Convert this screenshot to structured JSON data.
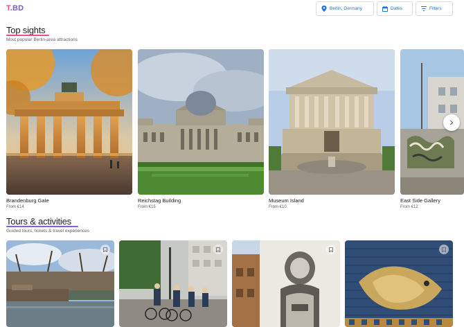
{
  "header": {
    "logo": {
      "t": "T",
      "dot": ".",
      "bd": "BD"
    },
    "location_chip": {
      "label": "Berlin, Germany",
      "icon": "location-pin-icon"
    },
    "dates_chip": {
      "label": "Dates",
      "icon": "calendar-icon"
    },
    "filters_chip": {
      "label": "Filters",
      "icon": "filter-icon"
    }
  },
  "top_sights": {
    "title": "Top sights",
    "subtitle": "Most popular Berlin-area attractions",
    "items": [
      {
        "name": "Brandenburg Gate",
        "price": "From €14"
      },
      {
        "name": "Reichstag Building",
        "price": "From €15"
      },
      {
        "name": "Museum Island",
        "price": "From €10"
      },
      {
        "name": "East Side Gallery",
        "price": "From €12"
      }
    ],
    "next_icon": "chevron-right-icon"
  },
  "tours": {
    "title": "Tours & activities",
    "subtitle": "Guided tours, tickets & travel experiences",
    "bookmark_icon": "bookmark-icon"
  },
  "colors": {
    "accent": "#1a73e8",
    "logo_pink": "#e8508a",
    "logo_purple": "#7b5cc8",
    "underline_sights": "#e8508a",
    "underline_tours": "#8e5bd6"
  }
}
